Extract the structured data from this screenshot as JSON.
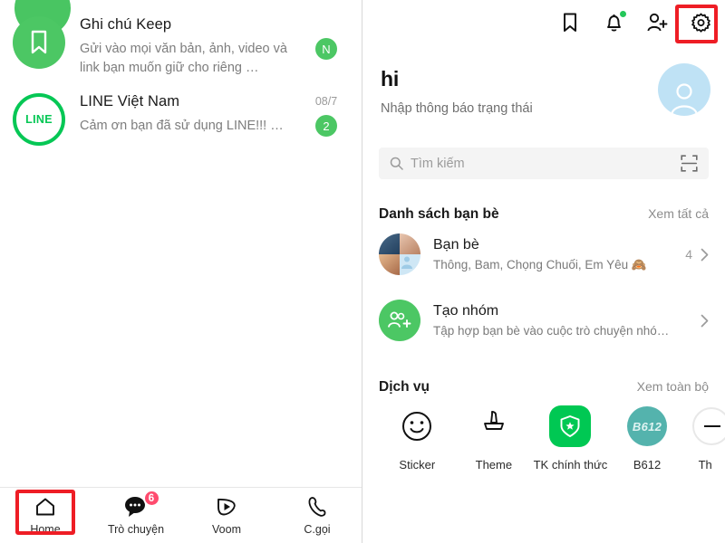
{
  "left_panel": {
    "chats": [
      {
        "avatar_icon": "bookmark-icon",
        "title": "Ghi chú Keep",
        "subtitle": "Gửi vào mọi văn bản, ảnh, video và link bạn muốn giữ cho riêng …",
        "date": "",
        "badge": "N"
      },
      {
        "avatar_icon": "line-logo-icon",
        "title": "LINE Việt Nam",
        "subtitle": "Cảm ơn bạn đã sử dụng LINE!!! …",
        "date": "08/7",
        "badge": "2"
      }
    ],
    "bottom_nav": [
      {
        "icon": "home-icon",
        "label": "Home",
        "badge": "",
        "selected": true
      },
      {
        "icon": "chat-bubble-icon",
        "label": "Trò chuyện",
        "badge": "6",
        "selected": false
      },
      {
        "icon": "voom-play-icon",
        "label": "Voom",
        "badge": "",
        "selected": false
      },
      {
        "icon": "phone-icon",
        "label": "C.gọi",
        "badge": "",
        "selected": false
      }
    ]
  },
  "right_panel": {
    "top_icons": [
      {
        "name": "bookmark-icon",
        "has_dot": false
      },
      {
        "name": "bell-icon",
        "has_dot": true
      },
      {
        "name": "add-friend-icon",
        "has_dot": false
      },
      {
        "name": "gear-icon",
        "has_dot": false
      }
    ],
    "profile": {
      "name": "hi",
      "status_placeholder": "Nhập thông báo trạng thái",
      "avatar_icon": "person-avatar-icon"
    },
    "search": {
      "placeholder": "Tìm kiếm",
      "icon": "search-icon",
      "scan_icon": "qr-scan-icon"
    },
    "friends_section": {
      "title": "Danh sách bạn bè",
      "link": "Xem tất cả",
      "rows": [
        {
          "title": "Bạn bè",
          "subtitle": "Thông, Bam, Chọng Chuối, Em Yêu 🙈",
          "count": "4",
          "chevron": "chevron-right-icon",
          "avatar_type": "photo-collage"
        },
        {
          "title": "Tạo nhóm",
          "subtitle": "Tập hợp bạn bè vào cuộc trò chuyện nhó…",
          "count": "",
          "chevron": "chevron-right-icon",
          "avatar_type": "add-group-icon"
        }
      ]
    },
    "services_section": {
      "title": "Dịch vụ",
      "link": "Xem toàn bộ",
      "items": [
        {
          "label": "Sticker",
          "icon": "smiley-face-icon"
        },
        {
          "label": "Theme",
          "icon": "brush-icon"
        },
        {
          "label": "TK chính thức",
          "icon": "shield-star-icon"
        },
        {
          "label": "B612",
          "icon": "b612-app-icon",
          "icon_text": "B612"
        },
        {
          "label": "Th",
          "icon": "cut-off-icon"
        }
      ]
    }
  },
  "highlights": {
    "home_nav_box": "red-highlight-box",
    "gear_icon_box": "red-highlight-box",
    "color": "#ee1d25"
  },
  "colors": {
    "line_green": "#06c755",
    "badge_green": "#4cc764",
    "badge_pink": "#ff4b6e",
    "avatar_blue": "#bfe2f5",
    "b612_teal": "#54b3ad"
  }
}
